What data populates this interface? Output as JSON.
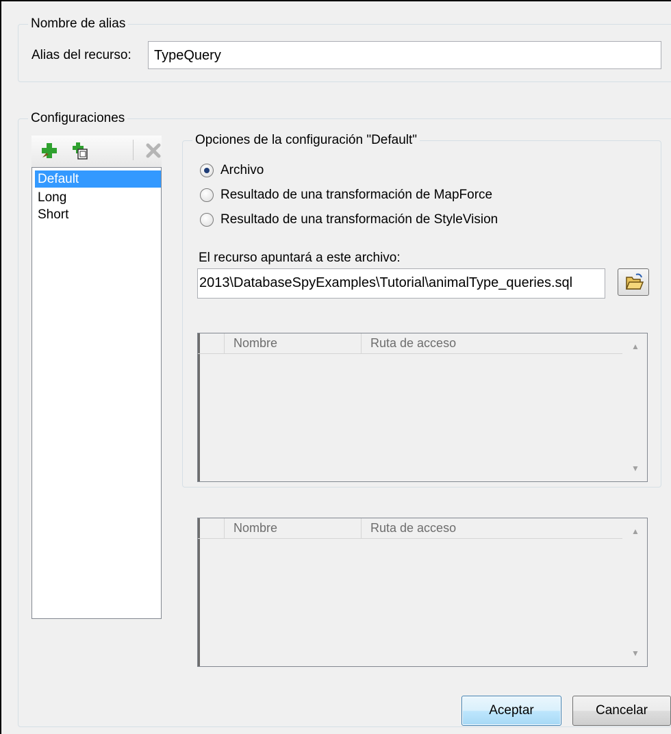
{
  "alias": {
    "group_title": "Nombre de alias",
    "label": "Alias del recurso:",
    "value": "TypeQuery"
  },
  "configurations": {
    "group_title": "Configuraciones",
    "toolbar": {
      "add_icon": "add-config-icon",
      "copy_icon": "copy-config-icon",
      "delete_icon": "delete-config-icon"
    },
    "items": [
      {
        "label": "Default",
        "selected": true
      },
      {
        "label": "Long",
        "selected": false
      },
      {
        "label": "Short",
        "selected": false
      }
    ]
  },
  "options": {
    "group_title": "Opciones de la configuración \"Default\"",
    "radios": [
      {
        "label": "Archivo",
        "checked": true
      },
      {
        "label": "Resultado de una transformación de MapForce",
        "checked": false
      },
      {
        "label": "Resultado de una transformación de StyleVision",
        "checked": false
      }
    ],
    "file_label": "El recurso apuntará a este archivo:",
    "file_value": "2013\\DatabaseSpyExamples\\Tutorial\\animalType_queries.sql",
    "browse_icon": "folder-open-icon",
    "grids": [
      {
        "col_name": "Nombre",
        "col_path": "Ruta de acceso"
      },
      {
        "col_name": "Nombre",
        "col_path": "Ruta de acceso"
      }
    ]
  },
  "buttons": {
    "ok": "Aceptar",
    "cancel": "Cancelar"
  },
  "colors": {
    "selection": "#3399ff",
    "add_green": "#2fa12f"
  }
}
